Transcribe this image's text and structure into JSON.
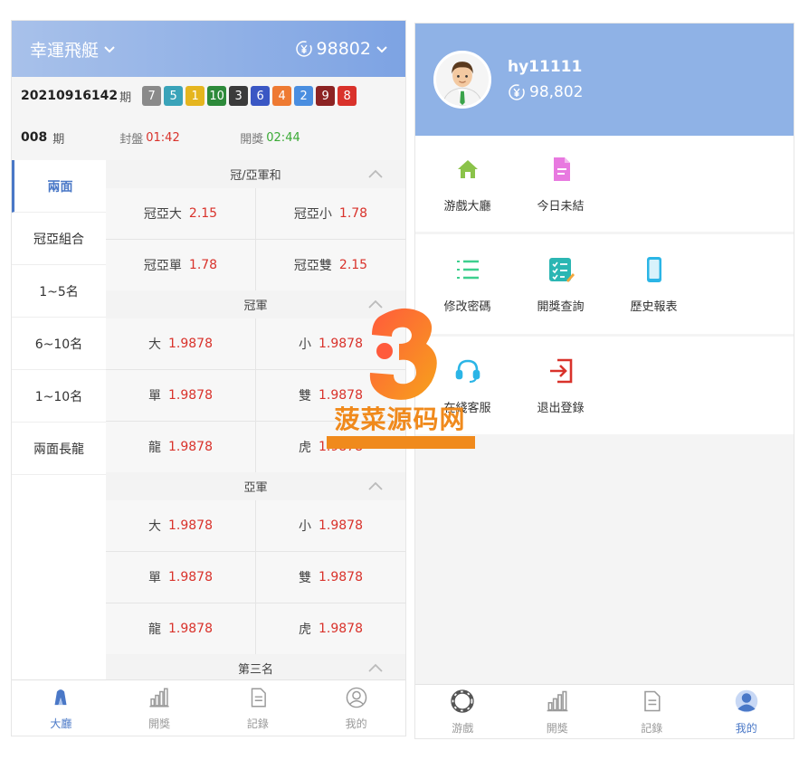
{
  "left": {
    "header": {
      "game_title": "幸運飛艇",
      "balance": "98802"
    },
    "last_draw": {
      "period": "20210916142",
      "period_suffix": "期",
      "balls": [
        {
          "n": "7",
          "color": "#8a8a8a"
        },
        {
          "n": "5",
          "color": "#3aa3b9"
        },
        {
          "n": "1",
          "color": "#e5b51f"
        },
        {
          "n": "10",
          "color": "#2d8a3a"
        },
        {
          "n": "3",
          "color": "#3b3b3b"
        },
        {
          "n": "6",
          "color": "#3a57c4"
        },
        {
          "n": "4",
          "color": "#ee7a32"
        },
        {
          "n": "2",
          "color": "#4a8ee0"
        },
        {
          "n": "9",
          "color": "#8c2323"
        },
        {
          "n": "8",
          "color": "#d9322b"
        }
      ]
    },
    "timer": {
      "current_period": "008",
      "current_suffix": "期",
      "close_label": "封盤",
      "close_time": "01:42",
      "draw_label": "開獎",
      "draw_time": "02:44"
    },
    "side_menu": [
      "兩面",
      "冠亞組合",
      "1~5名",
      "6~10名",
      "1~10名",
      "兩面長龍"
    ],
    "sections": [
      {
        "title": "冠/亞軍和",
        "bets": [
          {
            "name": "冠亞大",
            "odds": "2.15"
          },
          {
            "name": "冠亞小",
            "odds": "1.78"
          },
          {
            "name": "冠亞單",
            "odds": "1.78"
          },
          {
            "name": "冠亞雙",
            "odds": "2.15"
          }
        ]
      },
      {
        "title": "冠軍",
        "bets": [
          {
            "name": "大",
            "odds": "1.9878"
          },
          {
            "name": "小",
            "odds": "1.9878"
          },
          {
            "name": "單",
            "odds": "1.9878"
          },
          {
            "name": "雙",
            "odds": "1.9878"
          },
          {
            "name": "龍",
            "odds": "1.9878"
          },
          {
            "name": "虎",
            "odds": "1.9878"
          }
        ]
      },
      {
        "title": "亞軍",
        "bets": [
          {
            "name": "大",
            "odds": "1.9878"
          },
          {
            "name": "小",
            "odds": "1.9878"
          },
          {
            "name": "單",
            "odds": "1.9878"
          },
          {
            "name": "雙",
            "odds": "1.9878"
          },
          {
            "name": "龍",
            "odds": "1.9878"
          },
          {
            "name": "虎",
            "odds": "1.9878"
          }
        ]
      },
      {
        "title": "第三名",
        "bets": []
      }
    ],
    "tabbar": [
      {
        "label": "大廳",
        "icon": "home-icon"
      },
      {
        "label": "開獎",
        "icon": "bar-chart-icon"
      },
      {
        "label": "記錄",
        "icon": "document-icon"
      },
      {
        "label": "我的",
        "icon": "user-icon"
      }
    ]
  },
  "right": {
    "profile": {
      "username": "hy11111",
      "balance": "98,802"
    },
    "menu_groups": [
      [
        {
          "label": "游戲大廳",
          "icon": "home-icon",
          "color": "#8bc34a"
        },
        {
          "label": "今日未結",
          "icon": "file-icon",
          "color": "#e879e0"
        }
      ],
      [
        {
          "label": "修改密碼",
          "icon": "list-icon",
          "color": "#3dcf8e"
        },
        {
          "label": "開獎查詢",
          "icon": "checklist-icon",
          "color": "#2bb6b3"
        },
        {
          "label": "歷史報表",
          "icon": "phone-icon",
          "color": "#2bb5e6"
        }
      ],
      [
        {
          "label": "在綫客服",
          "icon": "headset-icon",
          "color": "#2bb5e6"
        },
        {
          "label": "退出登錄",
          "icon": "logout-icon",
          "color": "#d9322b"
        }
      ]
    ],
    "tabbar": [
      {
        "label": "游戲",
        "icon": "ring-icon"
      },
      {
        "label": "開獎",
        "icon": "bar-chart-icon"
      },
      {
        "label": "記錄",
        "icon": "document-icon"
      },
      {
        "label": "我的",
        "icon": "user-icon"
      }
    ]
  },
  "watermark": {
    "text": "菠菜源码网"
  },
  "colors": {
    "accent": "#4a78c7",
    "odds": "#d9322b",
    "draw_time": "#3aaa35",
    "header_blue": "#8fb2e6"
  }
}
